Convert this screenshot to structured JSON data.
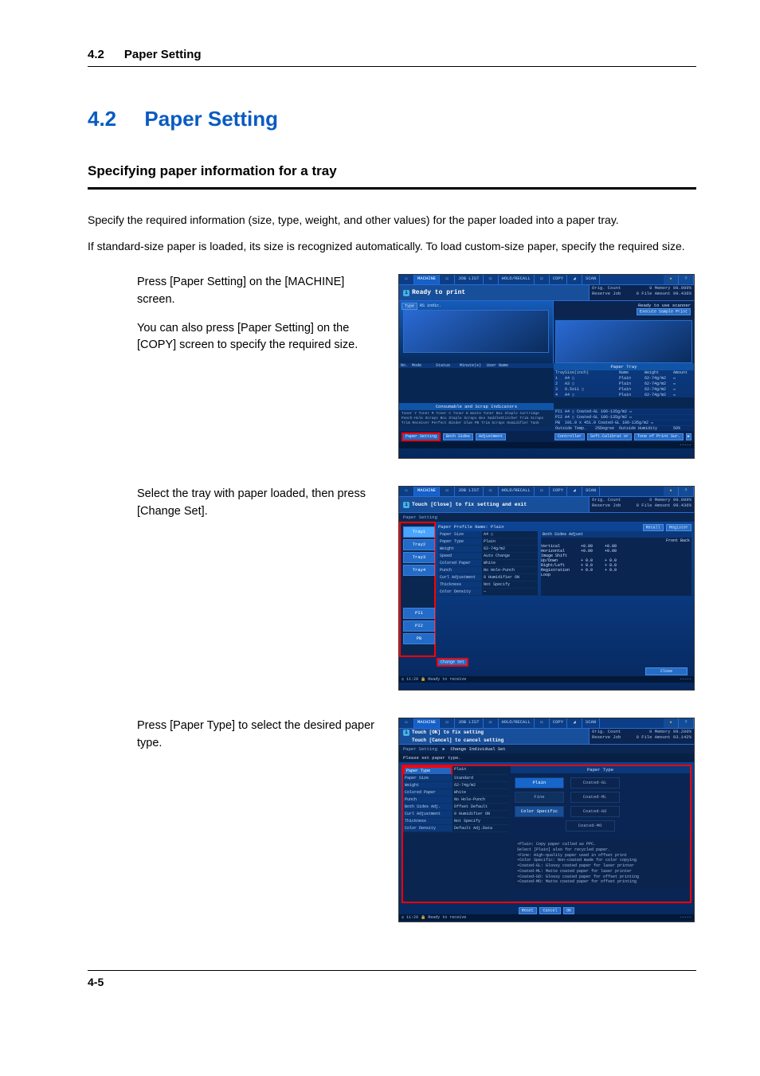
{
  "header": {
    "section_number": "4.2",
    "section_title": "Paper Setting"
  },
  "title": {
    "number": "4.2",
    "text": "Paper Setting"
  },
  "subheading": "Specifying paper information for a tray",
  "paragraphs": {
    "p1": "Specify the required information (size, type, weight, and other values) for the paper loaded into a paper tray.",
    "p2": "If standard-size paper is loaded, its size is recognized automatically. To load custom-size paper, specify the required size."
  },
  "steps": {
    "s1": {
      "l1": "Press [Paper Setting] on the [MACHINE] screen.",
      "l2": "You can also press [Paper Setting] on the [COPY] screen to specify the required size."
    },
    "s2": {
      "l1": "Select the tray with paper loaded, then press [Change Set]."
    },
    "s3": {
      "l1": "Press [Paper Type] to select the desired paper type."
    }
  },
  "screenshot_common": {
    "tab_machine": "MACHINE",
    "tab_joblist": "JOB LIST",
    "tab_recall": "HOLD/RECALL",
    "tab_copy": "COPY",
    "tab_scan": "SCAN",
    "help_icon": "?",
    "star_icon": "★",
    "orig_count_label": "Orig. Count",
    "orig_count_val": "0",
    "memory_label": "Memory",
    "memory_val": "99.999%",
    "reserve_label": "Reserve Job",
    "reserve_val": "0",
    "file_label": "File Amount",
    "file_val": "99.436%"
  },
  "ss1": {
    "status": "Ready to print",
    "sub_status": "Ready to use scanner",
    "sub_btn": "Execute Sample Print",
    "toggle_l": "Type",
    "toggle_r": "RS indic.",
    "jobs_header": {
      "no": "No.",
      "mode": "Mode",
      "status": "Status",
      "min": "Minute(s)",
      "user": "User Name"
    },
    "paper_tray_label": "Paper Tray",
    "tray_header": {
      "tray": "Tray",
      "size": "Size(inch)",
      "name": "Name",
      "weight": "Weight",
      "amount": "Amount"
    },
    "tray_rows": [
      {
        "tray": "1",
        "size": "A4 ▢",
        "name": "Plain",
        "weight": "62-74g/m2"
      },
      {
        "tray": "2",
        "size": "A3 ▢",
        "name": "Plain",
        "weight": "62-74g/m2"
      },
      {
        "tray": "3",
        "size": "8.5x11 ▢",
        "name": "Plain",
        "weight": "62-74g/m2"
      },
      {
        "tray": "4",
        "size": "A4 ▢",
        "name": "Plain",
        "weight": "62-74g/m2"
      }
    ],
    "ext_label": "PI1",
    "ext_row1": "A4 ▢   Coated-GL   106-135g/m2 ▭",
    "ext_label2": "PI2",
    "ext_row2": "A4 ▢   Coated-GL   106-135g/m2 ▭",
    "pb_label": "PB",
    "pb_row": "101.0 x 451.0   Coated-GL   106-135g/m2 ▭",
    "consumable_label": "Consumable and Scrap Indicators",
    "consumables": "Toner Y  Toner M  Toner C  Toner K  Waste Toner Box  Staple Cartridge  Punch-Hole Scraps Box  Staple Scraps Box  SaddleStitcher Trim Scraps  Trim Receiver  Perfect Binder Glue  PB Trim Scraps  Humidifier Tank",
    "outside_temp": "Outside Temp.",
    "outside_temp_val": "25Degree",
    "outside_humidity": "Outside Humidity",
    "outside_humidity_val": "50%",
    "btn_paper_setting": "Paper Setting",
    "btn_both_sides": "Both Sides",
    "btn_adjustment": "Adjustment",
    "btn_controller": "Controller",
    "btn_soft_cal": "Soft.Calibrat or",
    "btn_tone_print": "Tone of Print Sur.",
    "icon_arrow": "▶"
  },
  "ss2": {
    "status": "Touch [Close] to fix setting and exit",
    "crumb": "Paper Setting",
    "trays": [
      "Tray1",
      "Tray2",
      "Tray3",
      "Tray4"
    ],
    "pi_trays": [
      "PI1",
      "PI2",
      "PB"
    ],
    "profile_label": "Paper Profile Name",
    "profile_val": "Plain",
    "props": [
      [
        "Paper Size",
        "A4 ▢"
      ],
      [
        "Paper Type",
        "Plain"
      ],
      [
        "Weight",
        "62-74g/m2"
      ],
      [
        "Speed",
        "Auto Change"
      ],
      [
        "Colored Paper",
        "White"
      ],
      [
        "Punch",
        "No Hole-Punch"
      ],
      [
        "Curl Adjustment",
        "0 Humidifier ON"
      ],
      [
        "Thickness",
        "Not Specify"
      ],
      [
        "Color Density",
        "—"
      ]
    ],
    "both_sides_label": "Both Sides Adjust",
    "both_sides_cols": "Front    Back",
    "both_sides_rows": [
      [
        "Vertical",
        "+0.00",
        "+0.00"
      ],
      [
        "Horizontal",
        "+0.00",
        "+0.00"
      ],
      [
        "Image Shift",
        "",
        ""
      ],
      [
        "Up/Down",
        "+ 0.0",
        "+ 0.0"
      ],
      [
        "Right/Left",
        "+ 0.0",
        "+ 0.0"
      ],
      [
        "Registration Loop",
        "+ 0.0",
        "+ 0.0"
      ]
    ],
    "btn_recall": "Recall",
    "btn_register": "Register",
    "btn_change_set": "Change Set",
    "btn_close": "Close",
    "footer": "◎ 11:29 🔒 Ready to receive"
  },
  "ss3": {
    "status1": "Touch [OK] to fix setting",
    "status2": "Touch [Cancel] to cancel setting",
    "crumb1": "Paper Setting",
    "crumb2": "Change Individual Set",
    "prompt": "Please set paper type.",
    "props": [
      [
        "Paper Type",
        "Plain"
      ],
      [
        "Paper Size",
        "Standard"
      ],
      [
        "Weight",
        "62-74g/m2"
      ],
      [
        "Colored Paper",
        "White"
      ],
      [
        "Punch",
        "No Hole-Punch"
      ],
      [
        "Both Sides Adj.",
        "Offset Default"
      ],
      [
        "Curl Adjustment",
        "0 Humidifier ON"
      ],
      [
        "Thickness",
        "Not Specify"
      ],
      [
        "Color Density",
        "Default Adj.Data"
      ]
    ],
    "type_heading": "Paper Type",
    "type_options": [
      "Plain",
      "Coated-GL",
      "Fine",
      "Coated-ML",
      "Color Specific",
      "Coated-GO",
      "Coated-MO"
    ],
    "legend_lines": [
      "•Plain: Copy paper called as PPC.",
      "Select [Plain] also for recycled paper.",
      "•Fine: High-quality paper used in offset print",
      "•Color Specific: Non-coated made for color copying",
      "•Coated-GL: Glossy coated paper for laser printer",
      "•Coated-ML: Matte coated paper for laser printer",
      "•Coated-GO: Glossy coated paper for offset printing",
      "•Coated-MO: Matte coated paper for offset printing"
    ],
    "btn_reset": "Reset",
    "btn_cancel": "Cancel",
    "btn_ok": "OK",
    "footer": "◎ 11:29 🔒 Ready to receive"
  },
  "page_number": "4-5"
}
